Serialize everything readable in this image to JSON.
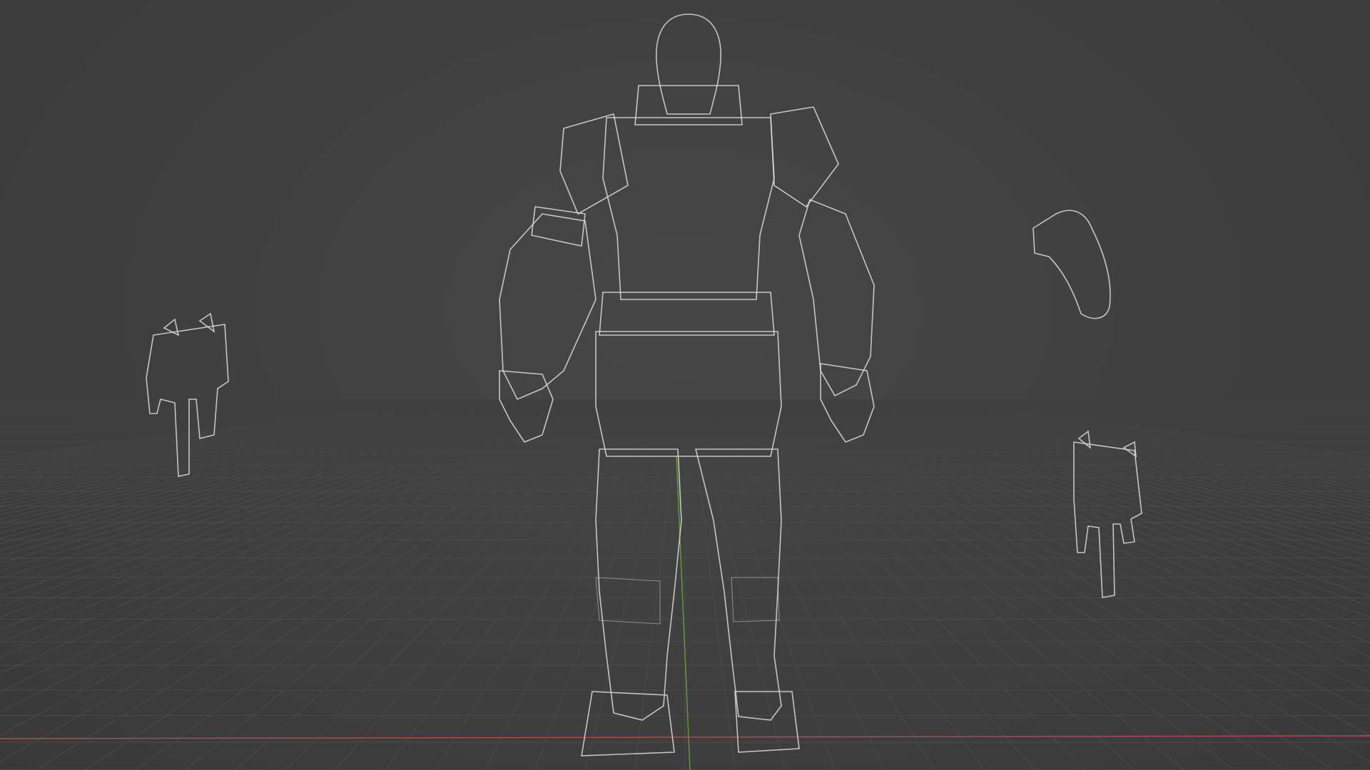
{
  "viewport": {
    "mode": "wireframe",
    "background_color": "#3d3d3d",
    "wire_color": "#d0d0d0",
    "grid_color": "#4a4a4a",
    "x_axis_color": "#b84a4a",
    "y_axis_color": "#6a9a3a"
  },
  "objects": [
    {
      "name": "soldier-character",
      "type": "mesh"
    },
    {
      "name": "smg-left",
      "type": "mesh"
    },
    {
      "name": "helmet-accessory",
      "type": "mesh"
    },
    {
      "name": "smg-right",
      "type": "mesh"
    }
  ]
}
